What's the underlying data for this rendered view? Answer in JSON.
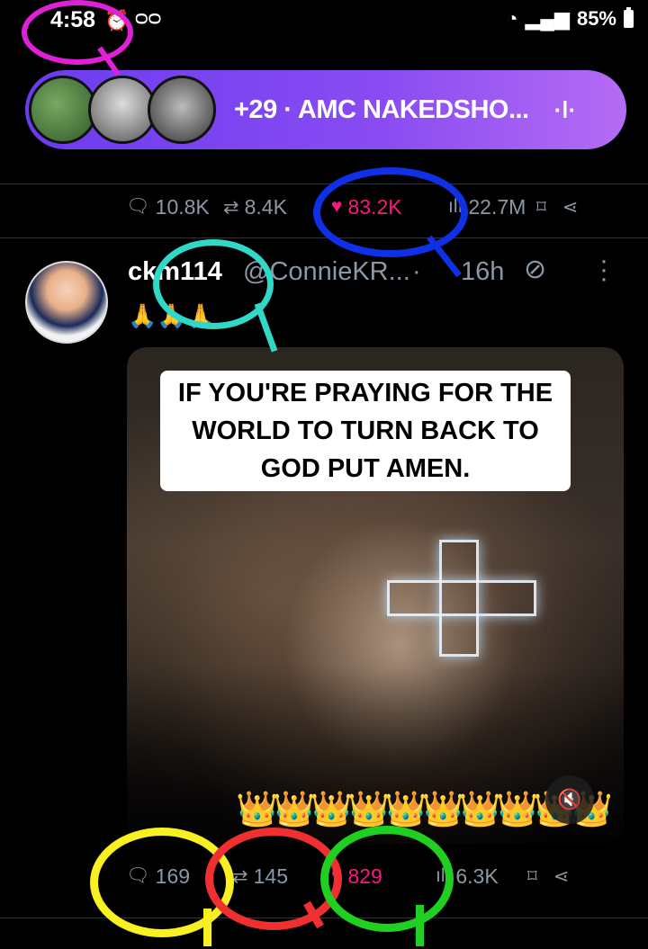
{
  "status_bar": {
    "time": "4:58",
    "battery": "85%",
    "icons": [
      "alarm-icon",
      "voicemail-icon",
      "wifi-icon",
      "signal-icon",
      "battery-icon"
    ]
  },
  "spaces": {
    "label": "+29 · AMC NAKEDSHO...",
    "gradient_start": "#6a3cf0",
    "gradient_end": "#b56cf4"
  },
  "prev_post_actions": {
    "replies": "10.8K",
    "reposts": "8.4K",
    "likes": "83.2K",
    "views": "22.7M"
  },
  "post": {
    "display_name": "ckm114",
    "handle": "@ConnieKR...",
    "separator": "·",
    "time": "16h",
    "text": "🙏🙏🙏",
    "media_caption": "IF YOU'RE PRAYING FOR THE WORLD TO TURN BACK TO GOD PUT AMEN.",
    "crowns": "👑👑👑👑👑👑👑👑👑👑",
    "actions": {
      "replies": "169",
      "reposts": "145",
      "likes": "829",
      "views": "6.3K"
    }
  },
  "colors": {
    "like_pink": "#f91880",
    "muted_gray": "#8b98a5",
    "ann_magenta": "#e020d8",
    "ann_blue": "#1030e8",
    "ann_teal": "#30d8c8",
    "ann_yellow": "#f8f020",
    "ann_red": "#f03030",
    "ann_green": "#20d020"
  }
}
